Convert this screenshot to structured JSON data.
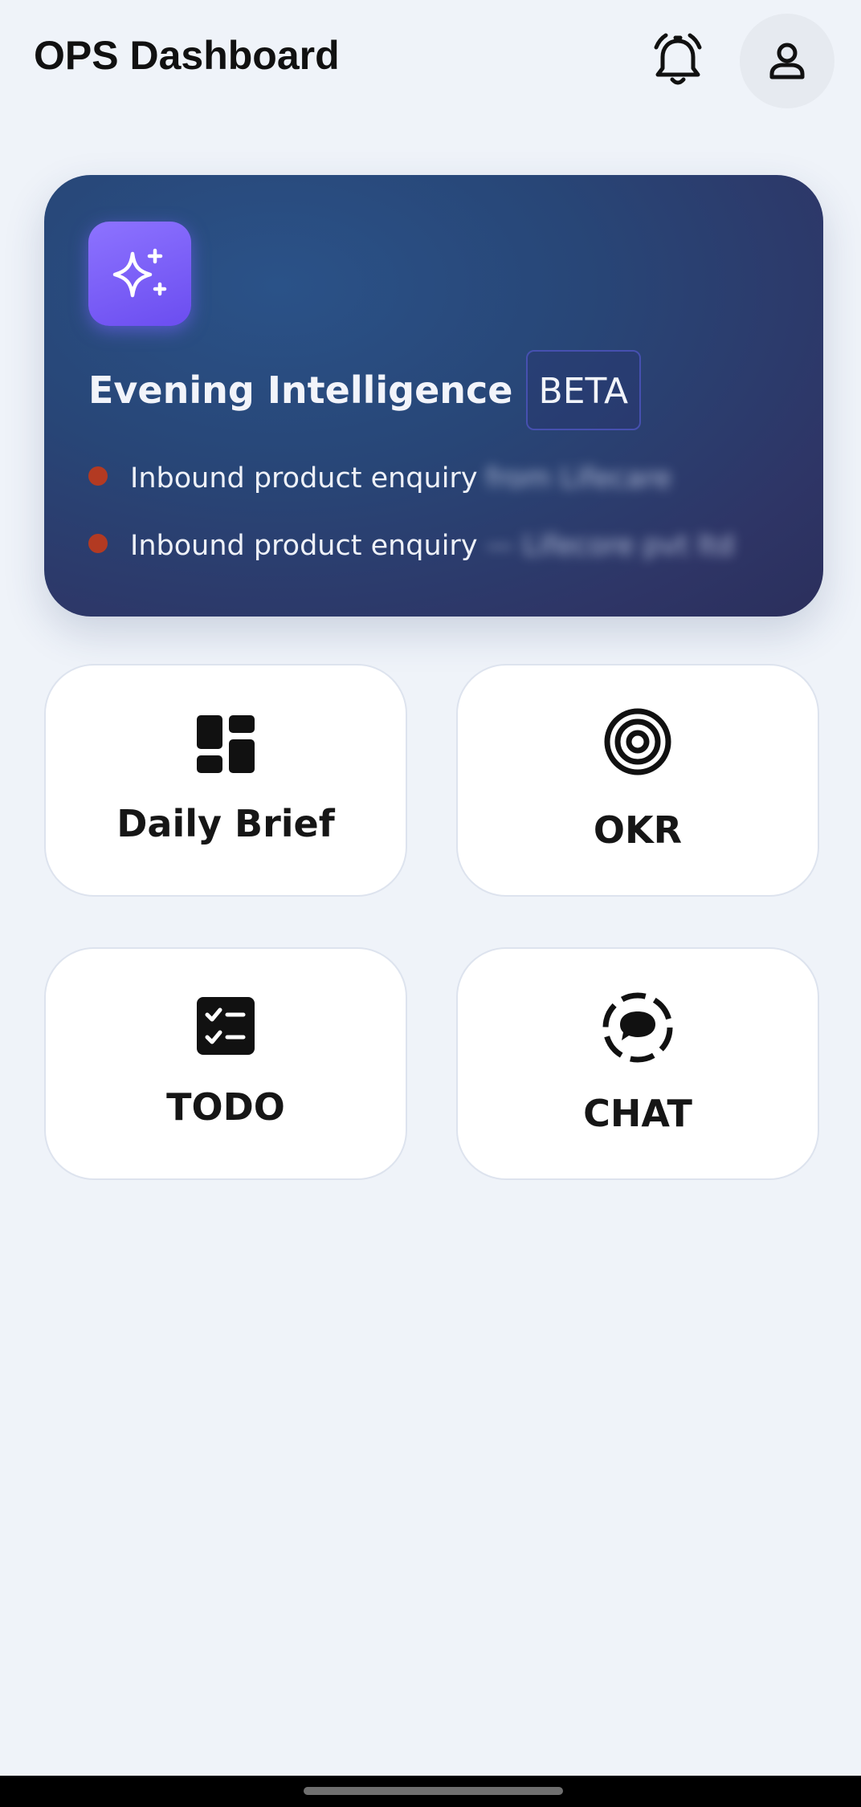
{
  "header": {
    "title": "OPS Dashboard",
    "bell_icon": "alarm-bell-icon",
    "profile_icon": "person-icon"
  },
  "intel_card": {
    "icon": "sparkle-icon",
    "title": "Evening Intelligence",
    "badge": "BETA",
    "items": [
      {
        "text": "Inbound product enquiry",
        "suffix": "from Lifecare"
      },
      {
        "text": "Inbound product enquiry",
        "suffix": "— Lifecore pvt ltd"
      }
    ],
    "colors": {
      "card_gradient_start": "#2a5288",
      "card_gradient_end": "#2b2f5c",
      "sparkle_tile": "#7b5ff8",
      "bullet_dot": "#b33a22"
    }
  },
  "tiles": [
    {
      "label": "Daily Brief",
      "icon": "dashboard-grid-icon"
    },
    {
      "label": "OKR",
      "icon": "target-icon"
    },
    {
      "label": "TODO",
      "icon": "checklist-icon"
    },
    {
      "label": "CHAT",
      "icon": "chat-bubble-icon"
    }
  ],
  "colors": {
    "background": "#eff3f9",
    "tile_background": "#ffffff",
    "text_primary": "#111111"
  }
}
